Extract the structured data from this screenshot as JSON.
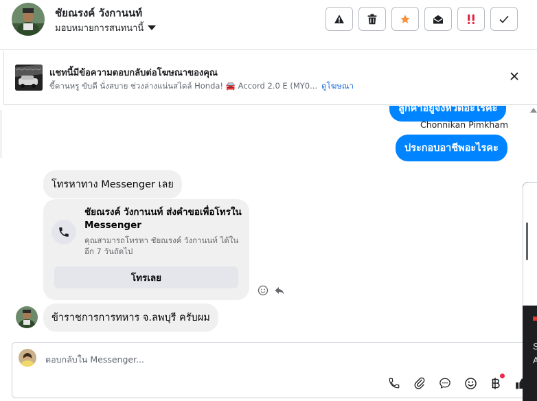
{
  "header": {
    "contact_name": "ชัยณรงค์ วังกานนท์",
    "assign_label": "มอบหมายการสนทนานี้",
    "actions": [
      {
        "name": "report-spam",
        "icon": "warning-icon"
      },
      {
        "name": "delete",
        "icon": "trash-icon"
      },
      {
        "name": "follow-up",
        "icon": "star-icon",
        "color": "#f7923b"
      },
      {
        "name": "mark-unread",
        "icon": "envelope-open-icon"
      },
      {
        "name": "priority",
        "icon": "double-exclamation-icon",
        "color": "#e41e3f"
      },
      {
        "name": "mark-done",
        "icon": "check-icon"
      }
    ]
  },
  "ad_banner": {
    "title": "แชทนี้มีข้อความตอบกลับต่อโฆษณาของคุณ",
    "subtitle": "ขี้ดานหรู ขับดี นั่งสบาย ช่วงล่างแน่นสไตล์ Honda! 🚘 Accord 2.0 E (MY0...",
    "link_label": "ดูโฆษณา"
  },
  "messages": {
    "outgoing_top_partial": "ลูกค้าอยู่จังหวัดอะไรคะ",
    "sender_name": "Chonnikan Pimkham",
    "outgoing": "ประกอบอาชีพอะไรคะ",
    "incoming_1": "โทรหาทาง Messenger เลย",
    "call_card": {
      "title": "ชัยณรงค์ วังกานนท์ ส่งคำขอเพื่อโทรใน Messenger",
      "description": "คุณสามารถโทรหา ชัยณรงค์ วังกานนท์ ได้ในอีก 7 วันถัดไป",
      "button_label": "โทรเลย"
    },
    "incoming_2": "ข้าราชการการทหาร จ.ลพบุรี ครับผม"
  },
  "composer": {
    "placeholder": "ตอบกลับใน Messenger...",
    "tools": [
      "phone-icon",
      "paperclip-icon",
      "chat-bubble-icon",
      "smiley-icon",
      "baht-icon",
      "thumbs-up-icon"
    ]
  },
  "side_panel": {
    "line1": "S",
    "line2": "A"
  },
  "colors": {
    "messenger_blue": "#0084ff",
    "link_blue": "#216fdb",
    "bubble_gray": "#f0f0f0",
    "follow_up_orange": "#f7923b",
    "priority_red": "#e41e3f"
  }
}
